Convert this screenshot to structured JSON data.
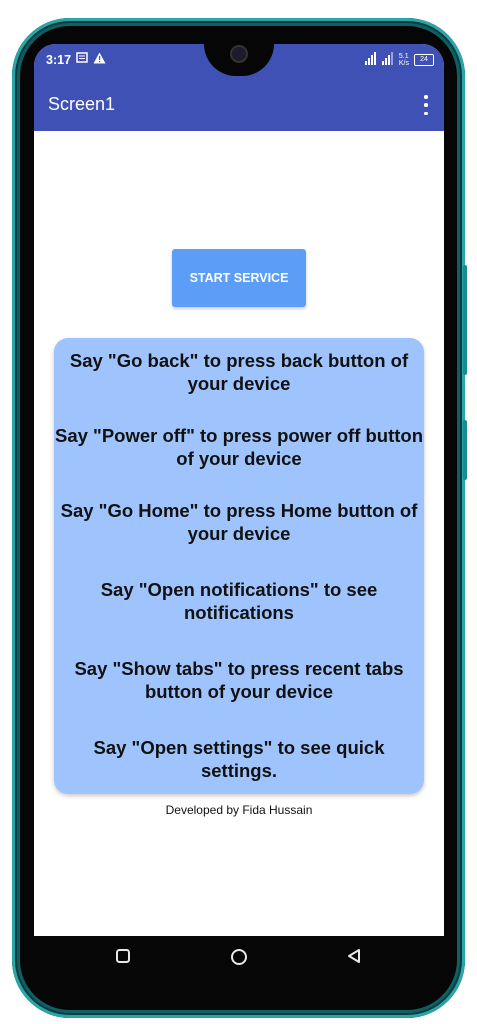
{
  "status_bar": {
    "time": "3:17",
    "left_icons": [
      "message-icon",
      "warning-icon"
    ],
    "right_icons": [
      "signal-icon",
      "signal-bars-icon",
      "data-speed-icon",
      "battery-icon"
    ],
    "data_speed": "5.1\nK/s",
    "battery_level": "24"
  },
  "app_bar": {
    "title": "Screen1"
  },
  "main": {
    "start_button_label": "START SERVICE",
    "instructions": [
      "Say \"Go back\" to press back button of your device",
      "Say \"Power off\" to press power off button of your device",
      "Say \"Go Home\" to press Home button of your device",
      "Say \"Open notifications\" to see notifications",
      "Say \"Show tabs\" to press recent tabs button of your device",
      "Say \"Open settings\" to see quick settings."
    ],
    "footer": "Developed by Fida Hussain"
  },
  "nav_bar": {
    "buttons": [
      "recents-icon",
      "home-icon",
      "back-icon"
    ]
  },
  "colors": {
    "app_bar": "#3f51b5",
    "button": "#5c9df7",
    "card": "#9fc4fd"
  }
}
